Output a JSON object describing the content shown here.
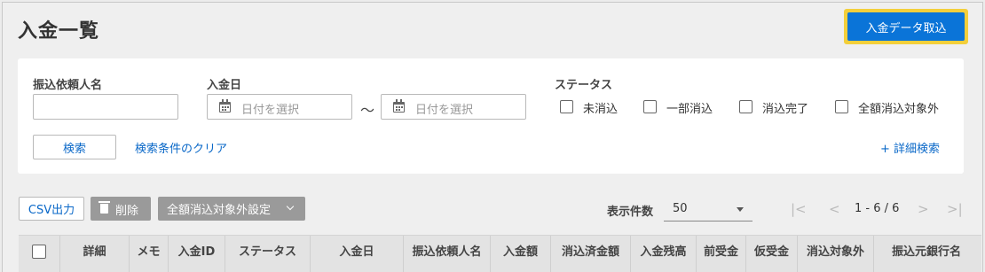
{
  "page": {
    "title": "入金一覧"
  },
  "header": {
    "import_button": "入金データ取込"
  },
  "filters": {
    "payer_label": "振込依頼人名",
    "payer_value": "",
    "date_label": "入金日",
    "date_from_placeholder": "日付を選択",
    "date_to_placeholder": "日付を選択",
    "date_separator": "〜",
    "status_label": "ステータス",
    "status_options": [
      {
        "label": "未消込",
        "checked": false
      },
      {
        "label": "一部消込",
        "checked": false
      },
      {
        "label": "消込完了",
        "checked": false
      },
      {
        "label": "全額消込対象外",
        "checked": false
      }
    ],
    "search_button": "検索",
    "clear_link": "検索条件のクリア",
    "advanced_link": "+ 詳細検索"
  },
  "toolbar": {
    "csv_button": "CSV出力",
    "delete_button": "削除",
    "exclude_button": "全額消込対象外設定",
    "count_label": "表示件数",
    "count_value": "50",
    "pagination": "1 - 6 / 6"
  },
  "table": {
    "columns": [
      "詳細",
      "メモ",
      "入金ID",
      "ステータス",
      "入金日",
      "振込依頼人名",
      "入金額",
      "消込済金額",
      "入金残高",
      "前受金",
      "仮受金",
      "消込対象外",
      "振込元銀行名"
    ]
  },
  "icons": {
    "calendar": "calendar-icon",
    "trash": "trash-icon",
    "chevron": "chevron-down-icon",
    "first": "|<",
    "prev": "<",
    "next": ">",
    "last": ">|"
  },
  "colors": {
    "primary": "#0a74d8",
    "highlight": "#f3cf3b",
    "link": "#0a68c8",
    "disabled_button": "#9a9a9a"
  }
}
